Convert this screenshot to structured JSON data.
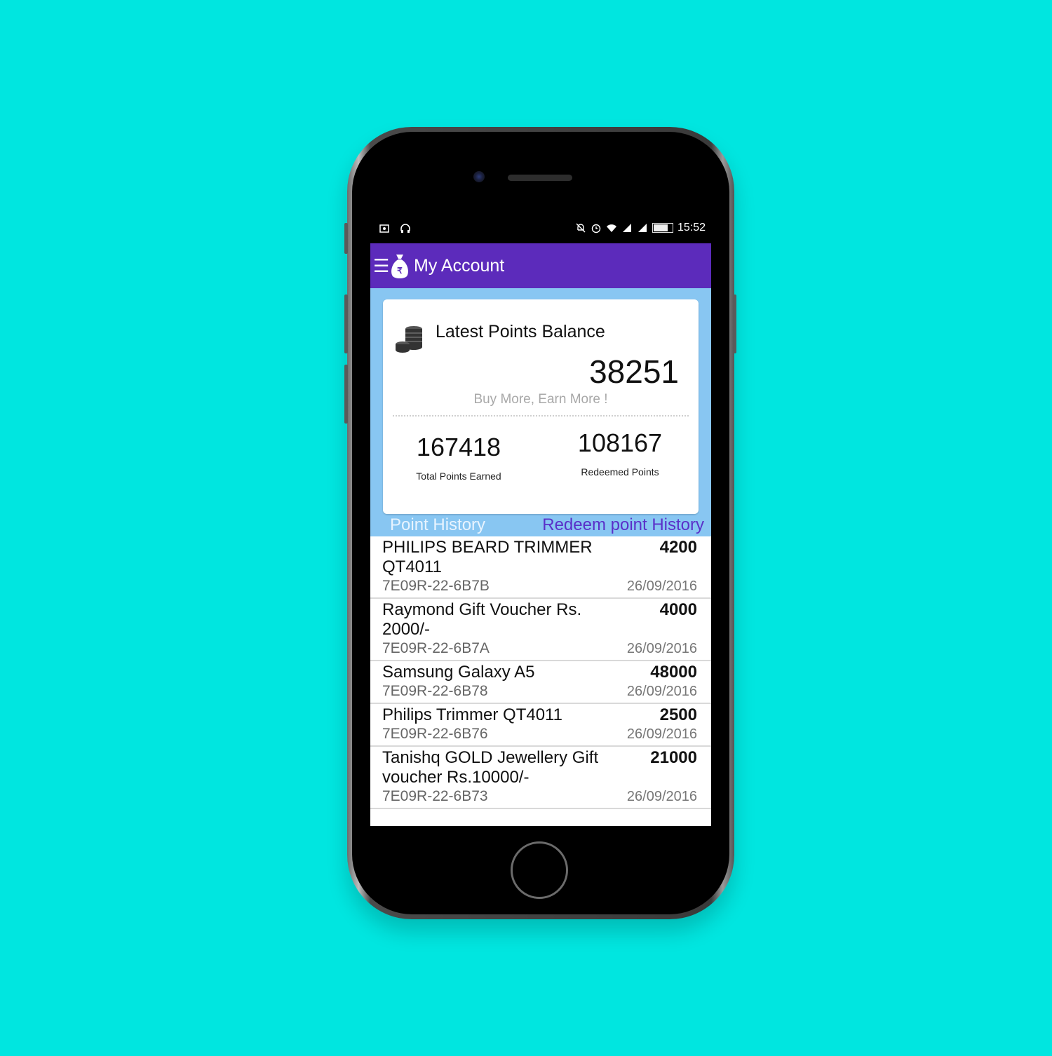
{
  "status_bar": {
    "time": "15:52"
  },
  "appbar": {
    "title": "My Account"
  },
  "card": {
    "title": "Latest Points Balance",
    "balance": "38251",
    "tagline": "Buy More, Earn More !",
    "total_points": "167418",
    "total_label": "Total Points Earned",
    "redeemed_points": "108167",
    "redeemed_label": "Redeemed Points"
  },
  "tabs": {
    "point_history": "Point History",
    "redeem_history": "Redeem point History"
  },
  "items": [
    {
      "name": "PHILIPS BEARD TRIMMER QT4011",
      "points": "4200",
      "code": "7E09R-22-6B7B",
      "date": "26/09/2016"
    },
    {
      "name": "Raymond Gift Voucher Rs. 2000/-",
      "points": "4000",
      "code": "7E09R-22-6B7A",
      "date": "26/09/2016"
    },
    {
      "name": "Samsung Galaxy A5",
      "points": "48000",
      "code": "7E09R-22-6B78",
      "date": "26/09/2016"
    },
    {
      "name": "Philips Trimmer QT4011",
      "points": "2500",
      "code": "7E09R-22-6B76",
      "date": "26/09/2016"
    },
    {
      "name": "Tanishq GOLD Jewellery Gift voucher Rs.10000/-",
      "points": "21000",
      "code": "7E09R-22-6B73",
      "date": "26/09/2016"
    }
  ],
  "colors": {
    "background": "#00e6e0",
    "appbar": "#5c2bbb",
    "card_bg": "#88c6f2",
    "tab_active": "#5a30c9"
  }
}
